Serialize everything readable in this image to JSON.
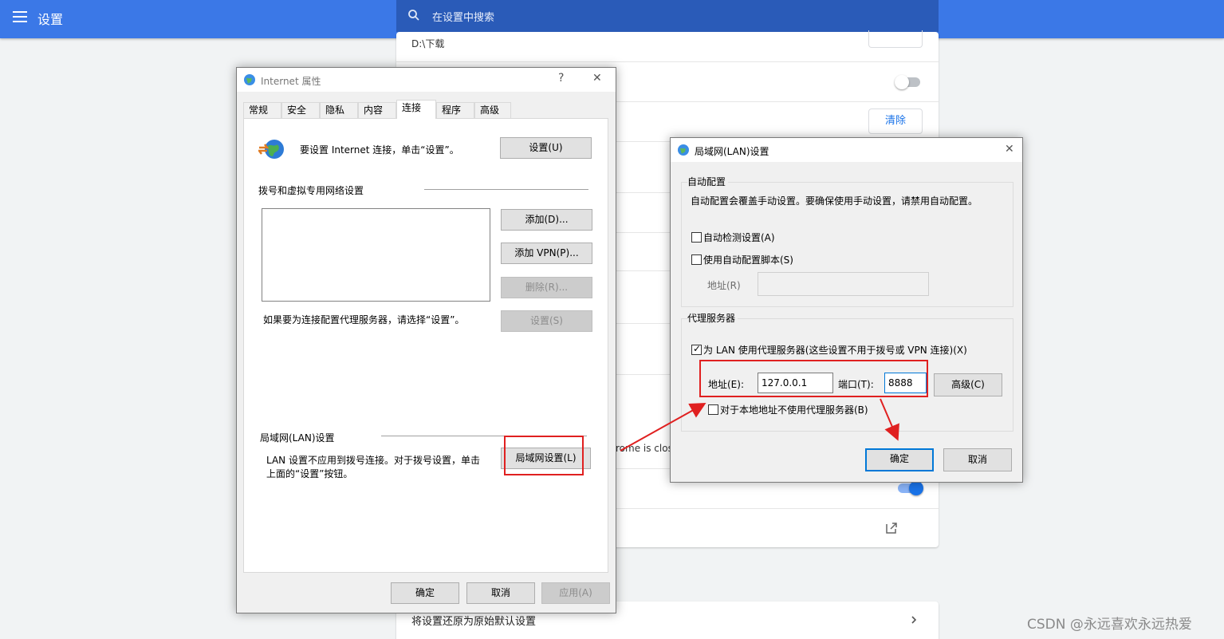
{
  "chrome": {
    "title": "设置",
    "search_placeholder": "在设置中搜索",
    "download_path": "D:\\下载",
    "clear_label": "清除",
    "close_text": "rome is clos",
    "reset_label": "将设置还原为原始默认设置",
    "toggle_one_on": false,
    "toggle_two_on": true
  },
  "inet": {
    "title": "Internet 属性",
    "help": "?",
    "close": "✕",
    "tabs": [
      "常规",
      "安全",
      "隐私",
      "内容",
      "连接",
      "程序",
      "高级"
    ],
    "active_tab": "连接",
    "setup_text": "要设置 Internet 连接，单击“设置”。",
    "setup_btn": "设置(U)",
    "dial_header": "拨号和虚拟专用网络设置",
    "add_btn": "添加(D)...",
    "add_vpn_btn": "添加 VPN(P)...",
    "remove_btn": "删除(R)...",
    "settings_btn": "设置(S)",
    "proxy_hint": "如果要为连接配置代理服务器，请选择“设置”。",
    "lan_header": "局域网(LAN)设置",
    "lan_desc_1": "LAN 设置不应用到拨号连接。对于拨号设置，单击",
    "lan_desc_2": "上面的“设置”按钮。",
    "lan_btn": "局域网设置(L)",
    "ok": "确定",
    "cancel": "取消",
    "apply": "应用(A)"
  },
  "lan": {
    "title": "局域网(LAN)设置",
    "close": "✕",
    "auto_group": "自动配置",
    "auto_desc": "自动配置会覆盖手动设置。要确保使用手动设置，请禁用自动配置。",
    "auto_detect": "自动检测设置(A)",
    "auto_detect_checked": false,
    "auto_script": "使用自动配置脚本(S)",
    "auto_script_checked": false,
    "script_addr_label": "地址(R)",
    "script_addr_value": "",
    "proxy_group": "代理服务器",
    "use_proxy": "为 LAN 使用代理服务器(这些设置不用于拨号或 VPN 连接)(X)",
    "use_proxy_checked": true,
    "addr_label": "地址(E):",
    "addr_value": "127.0.0.1",
    "port_label": "端口(T):",
    "port_value": "8888",
    "advanced_btn": "高级(C)",
    "bypass_local": "对于本地地址不使用代理服务器(B)",
    "bypass_local_checked": false,
    "ok": "确定",
    "cancel": "取消"
  },
  "watermark": "CSDN @永远喜欢永远热爱",
  "colors": {
    "chrome_blue": "#3b78e7",
    "search_blue": "#2a5bb8",
    "annotation_red": "#e02020",
    "default_button_border": "#0078d7"
  }
}
